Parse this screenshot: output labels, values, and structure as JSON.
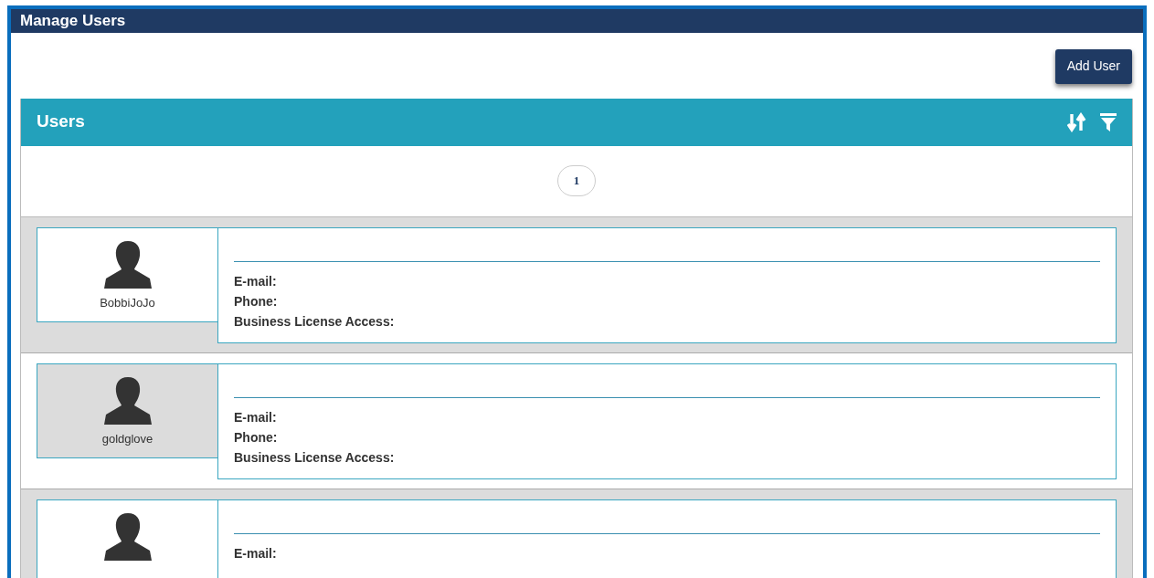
{
  "window": {
    "title": "Manage Users"
  },
  "add_button": "Add User",
  "panel": {
    "title": "Users",
    "pagination": [
      {
        "label": "1",
        "selected": true
      }
    ]
  },
  "users": [
    {
      "username": "BobbiJoJo",
      "shaded": true,
      "fields": [
        "E-mail:",
        "Phone:",
        "Business License Access:"
      ]
    },
    {
      "username": "goldglove",
      "shaded": false,
      "fields": [
        "E-mail:",
        "Phone:",
        "Business License Access:"
      ]
    },
    {
      "shaded": true,
      "fields": [
        "E-mail:"
      ]
    }
  ]
}
